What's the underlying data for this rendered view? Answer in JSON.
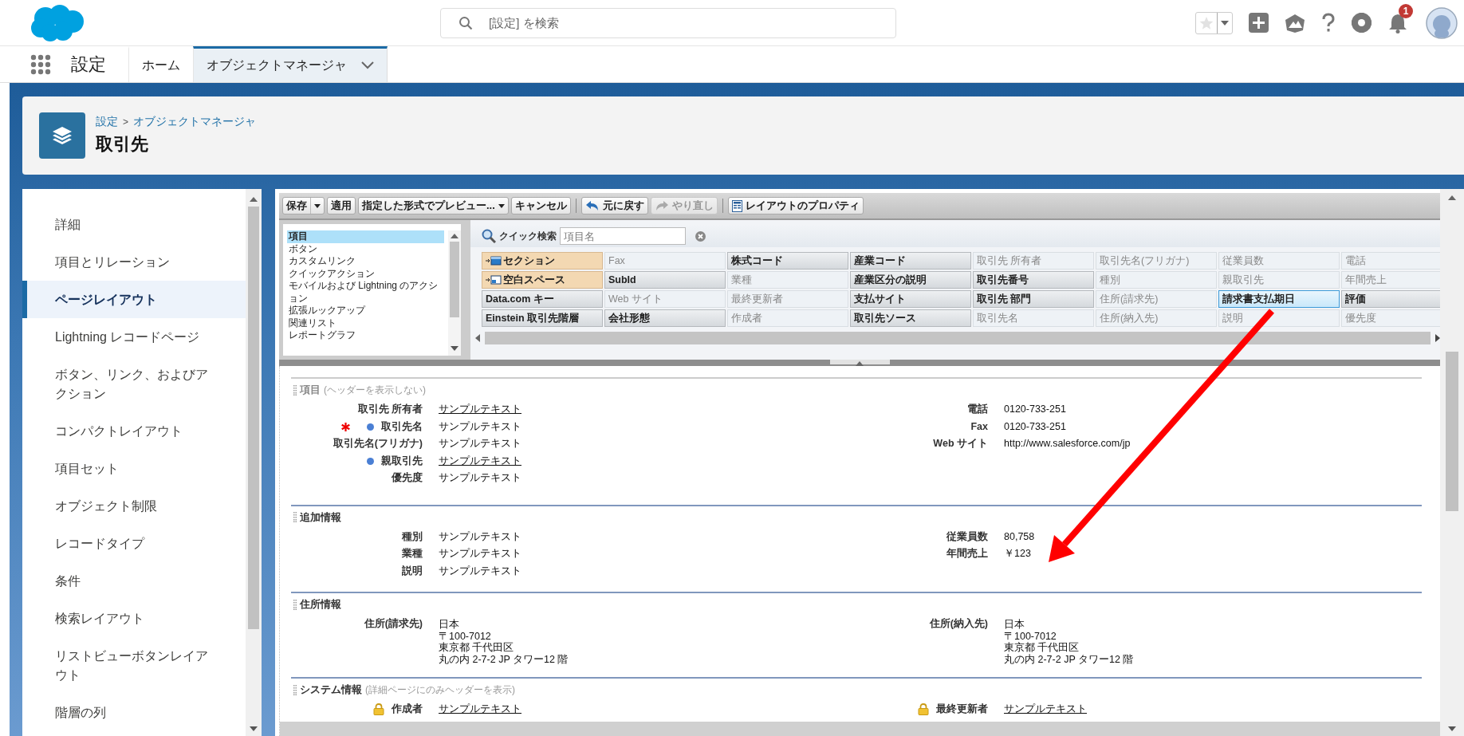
{
  "header": {
    "search": {
      "placeholder": "[設定] を検索"
    },
    "notifications": {
      "count": "1"
    }
  },
  "nav": {
    "app_name": "設定",
    "tabs": [
      {
        "label": "ホーム",
        "selected": false,
        "has_menu": false
      },
      {
        "label": "オブジェクトマネージャ",
        "selected": true,
        "has_menu": true
      }
    ]
  },
  "page_header": {
    "breadcrumb": [
      {
        "label": "設定"
      },
      {
        "label": "オブジェクトマネージャ"
      }
    ],
    "breadcrumb_separator": ">",
    "title": "取引先"
  },
  "sidebar": {
    "items": [
      {
        "label": "詳細",
        "selected": false
      },
      {
        "label": "項目とリレーション",
        "selected": false
      },
      {
        "label": "ページレイアウト",
        "selected": true
      },
      {
        "label": "Lightning レコードページ",
        "selected": false
      },
      {
        "label": "ボタン、リンク、およびアクション",
        "selected": false
      },
      {
        "label": "コンパクトレイアウト",
        "selected": false
      },
      {
        "label": "項目セット",
        "selected": false
      },
      {
        "label": "オブジェクト制限",
        "selected": false
      },
      {
        "label": "レコードタイプ",
        "selected": false
      },
      {
        "label": "条件",
        "selected": false
      },
      {
        "label": "検索レイアウト",
        "selected": false
      },
      {
        "label": "リストビューボタンレイアウト",
        "selected": false
      },
      {
        "label": "階層の列",
        "selected": false
      }
    ]
  },
  "editor": {
    "toolbar": [
      {
        "kind": "split_button",
        "label": "保存",
        "disabled": false
      },
      {
        "kind": "button",
        "label": "適用",
        "disabled": false
      },
      {
        "kind": "menu_button",
        "label": "指定した形式でプレビュー...",
        "disabled": false
      },
      {
        "kind": "button",
        "label": "キャンセル",
        "disabled": false
      },
      {
        "kind": "separator"
      },
      {
        "kind": "undo_button",
        "label": "元に戻す",
        "disabled": false
      },
      {
        "kind": "redo_button",
        "label": "やり直し",
        "disabled": true
      },
      {
        "kind": "separator"
      },
      {
        "kind": "properties_button",
        "label": "レイアウトのプロパティ",
        "disabled": false
      }
    ],
    "palette": {
      "categories": [
        {
          "label": "項目",
          "selected": true
        },
        {
          "label": "ボタン",
          "selected": false
        },
        {
          "label": "カスタムリンク",
          "selected": false
        },
        {
          "label": "クイックアクション",
          "selected": false
        },
        {
          "label": "モバイルおよび Lightning のアクション",
          "selected": false
        },
        {
          "label": "拡張ルックアップ",
          "selected": false
        },
        {
          "label": "関連リスト",
          "selected": false
        },
        {
          "label": "レポートグラフ",
          "selected": false
        }
      ],
      "quick_find": {
        "label": "クイック検索",
        "placeholder": "項目名"
      },
      "items": [
        {
          "label": "セクション",
          "kind": "section",
          "selected": false
        },
        {
          "label": "Fax",
          "kind": "field",
          "in_layout": true,
          "selected": false
        },
        {
          "label": "株式コード",
          "kind": "field",
          "in_layout": false,
          "selected": false
        },
        {
          "label": "産業コード",
          "kind": "field",
          "in_layout": false,
          "selected": false
        },
        {
          "label": "取引先 所有者",
          "kind": "field",
          "in_layout": true,
          "selected": false
        },
        {
          "label": "取引先名(フリガナ)",
          "kind": "field",
          "in_layout": true,
          "selected": false
        },
        {
          "label": "従業員数",
          "kind": "field",
          "in_layout": true,
          "selected": false
        },
        {
          "label": "電話",
          "kind": "field",
          "in_layout": true,
          "selected": false
        },
        {
          "label": "空白スペース",
          "kind": "blank_space",
          "selected": false
        },
        {
          "label": "SubId",
          "kind": "field",
          "in_layout": false,
          "selected": false
        },
        {
          "label": "業種",
          "kind": "field",
          "in_layout": true,
          "selected": false
        },
        {
          "label": "産業区分の説明",
          "kind": "field",
          "in_layout": false,
          "selected": false
        },
        {
          "label": "取引先番号",
          "kind": "field",
          "in_layout": false,
          "selected": false
        },
        {
          "label": "種別",
          "kind": "field",
          "in_layout": true,
          "selected": false
        },
        {
          "label": "親取引先",
          "kind": "field",
          "in_layout": true,
          "selected": false
        },
        {
          "label": "年間売上",
          "kind": "field",
          "in_layout": true,
          "selected": false
        },
        {
          "label": "Data.com キー",
          "kind": "field",
          "in_layout": false,
          "selected": false
        },
        {
          "label": "Web サイト",
          "kind": "field",
          "in_layout": true,
          "selected": false
        },
        {
          "label": "最終更新者",
          "kind": "field",
          "in_layout": true,
          "selected": false
        },
        {
          "label": "支払サイト",
          "kind": "field",
          "in_layout": false,
          "selected": false
        },
        {
          "label": "取引先 部門",
          "kind": "field",
          "in_layout": false,
          "selected": false
        },
        {
          "label": "住所(請求先)",
          "kind": "field",
          "in_layout": true,
          "selected": false
        },
        {
          "label": "請求書支払期日",
          "kind": "field",
          "in_layout": false,
          "selected": true
        },
        {
          "label": "評価",
          "kind": "field",
          "in_layout": false,
          "selected": false
        },
        {
          "label": "Einstein 取引先階層",
          "kind": "field",
          "in_layout": false,
          "selected": false
        },
        {
          "label": "会社形態",
          "kind": "field",
          "in_layout": false,
          "selected": false
        },
        {
          "label": "作成者",
          "kind": "field",
          "in_layout": true,
          "selected": false
        },
        {
          "label": "取引先ソース",
          "kind": "field",
          "in_layout": false,
          "selected": false
        },
        {
          "label": "取引先名",
          "kind": "field",
          "in_layout": true,
          "selected": false
        },
        {
          "label": "住所(納入先)",
          "kind": "field",
          "in_layout": true,
          "selected": false
        },
        {
          "label": "説明",
          "kind": "field",
          "in_layout": true,
          "selected": false
        },
        {
          "label": "優先度",
          "kind": "field",
          "in_layout": true,
          "selected": false
        }
      ]
    }
  },
  "layout": {
    "sections": [
      {
        "title": "項目",
        "note": "(ヘッダーを表示しない)",
        "columns": [
          [
            {
              "label": "取引先 所有者",
              "value": "サンプルテキスト",
              "link": true,
              "always_on_layout": false,
              "required": false,
              "locked": false
            },
            {
              "label": "取引先名",
              "value": "サンプルテキスト",
              "link": false,
              "always_on_layout": true,
              "required": true,
              "locked": false
            },
            {
              "label": "取引先名(フリガナ)",
              "value": "サンプルテキスト",
              "link": false,
              "always_on_layout": false,
              "required": false,
              "locked": false
            },
            {
              "label": "親取引先",
              "value": "サンプルテキスト",
              "link": true,
              "always_on_layout": false,
              "required": true,
              "locked": false
            },
            {
              "label": "優先度",
              "value": "サンプルテキスト",
              "link": false,
              "always_on_layout": false,
              "required": false,
              "locked": false
            }
          ],
          [
            {
              "label": "電話",
              "value": "0120-733-251",
              "link": false,
              "always_on_layout": false,
              "required": false,
              "locked": false
            },
            {
              "label": "Fax",
              "value": "0120-733-251",
              "link": false,
              "always_on_layout": false,
              "required": false,
              "locked": false
            },
            {
              "label": "Web サイト",
              "value": "http://www.salesforce.com/jp",
              "link": false,
              "always_on_layout": false,
              "required": false,
              "locked": false
            }
          ]
        ]
      },
      {
        "title": "追加情報",
        "columns": [
          [
            {
              "label": "種別",
              "value": "サンプルテキスト",
              "link": false,
              "always_on_layout": false,
              "required": false,
              "locked": false
            },
            {
              "label": "業種",
              "value": "サンプルテキスト",
              "link": false,
              "always_on_layout": false,
              "required": false,
              "locked": false
            },
            {
              "label": "説明",
              "value": "サンプルテキスト",
              "link": false,
              "always_on_layout": false,
              "required": false,
              "locked": false
            }
          ],
          [
            {
              "label": "従業員数",
              "value": "80,758",
              "link": false,
              "always_on_layout": false,
              "required": false,
              "locked": false
            },
            {
              "label": "年間売上",
              "value": "￥123",
              "link": false,
              "always_on_layout": false,
              "required": false,
              "locked": false
            }
          ]
        ]
      },
      {
        "title": "住所情報",
        "columns": [
          [
            {
              "label": "住所(請求先)",
              "value_lines": [
                "日本",
                "〒100-7012",
                "東京都 千代田区",
                "丸の内 2-7-2 JP タワー12 階"
              ],
              "link": false,
              "always_on_layout": false,
              "required": false,
              "locked": false
            }
          ],
          [
            {
              "label": "住所(納入先)",
              "value_lines": [
                "日本",
                "〒100-7012",
                "東京都 千代田区",
                "丸の内 2-7-2 JP タワー12 階"
              ],
              "link": false,
              "always_on_layout": false,
              "required": false,
              "locked": false
            }
          ]
        ]
      },
      {
        "title": "システム情報",
        "note": "(詳細ページにのみヘッダーを表示)",
        "columns": [
          [
            {
              "label": "作成者",
              "value": "サンプルテキスト",
              "link": true,
              "always_on_layout": false,
              "required": false,
              "locked": true
            }
          ],
          [
            {
              "label": "最終更新者",
              "value": "サンプルテキスト",
              "link": true,
              "always_on_layout": false,
              "required": false,
              "locked": true
            }
          ]
        ]
      }
    ]
  }
}
